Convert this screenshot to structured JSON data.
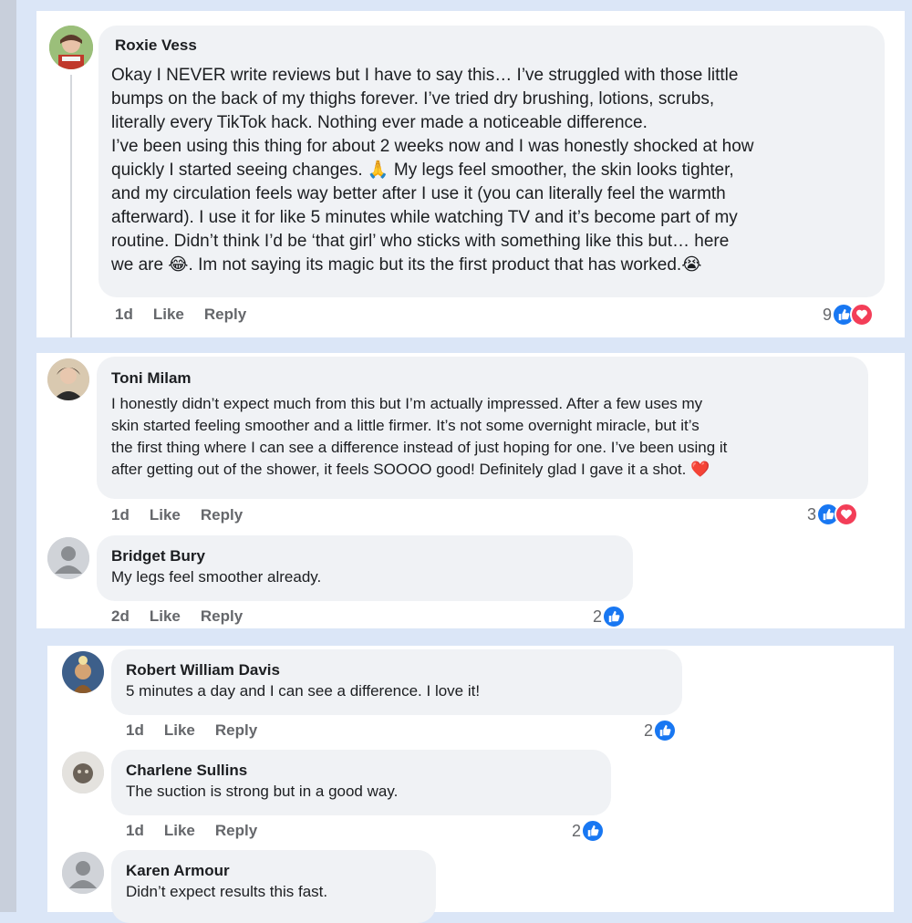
{
  "comments": [
    {
      "name": "Roxie Vess",
      "lines": [
        "Okay I NEVER write reviews but I have to say this… I’ve struggled with those little",
        "bumps on the back of my thighs forever. I’ve tried dry brushing, lotions, scrubs,",
        "literally every TikTok hack. Nothing ever made a noticeable difference.",
        "I’ve been using this thing for about 2 weeks now and I was honestly shocked at how",
        "quickly I started seeing changes. 🙏 My legs feel smoother, the skin looks tighter,",
        "and my circulation feels way better after I use it (you can literally feel the warmth",
        "afterward). I use it for like 5 minutes while watching TV and it’s become part of my",
        "routine. Didn’t think I’d be ‘that girl’ who sticks with something like this but… here",
        "we are 😂. Im not saying its magic but its the first product that has worked.😭"
      ],
      "time": "1d",
      "like": "Like",
      "reply": "Reply",
      "count": "9",
      "reactions": [
        "like-icon",
        "love-icon"
      ]
    },
    {
      "name": "Toni Milam",
      "lines": [
        "I honestly didn’t expect much from this but I’m actually impressed. After a few uses my",
        "skin started feeling smoother and a little firmer. It’s not some overnight miracle, but it’s",
        "the first thing where I can see a difference instead of just hoping for one. I’ve been using it",
        "after getting out of the shower, it feels SOOOO good! Definitely glad I gave it a shot. ❤️"
      ],
      "time": "1d",
      "like": "Like",
      "reply": "Reply",
      "count": "3",
      "reactions": [
        "like-icon",
        "love-icon"
      ]
    },
    {
      "name": "Bridget Bury",
      "lines": [
        "My legs feel smoother already."
      ],
      "time": "2d",
      "like": "Like",
      "reply": "Reply",
      "count": "2",
      "reactions": [
        "like-icon"
      ]
    },
    {
      "name": "Robert William Davis",
      "lines": [
        "5 minutes a day and I can see a difference. I love it!"
      ],
      "time": "1d",
      "like": "Like",
      "reply": "Reply",
      "count": "2",
      "reactions": [
        "like-icon"
      ]
    },
    {
      "name": "Charlene Sullins",
      "lines": [
        "The suction is strong but in a good way."
      ],
      "time": "1d",
      "like": "Like",
      "reply": "Reply",
      "count": "2",
      "reactions": [
        "like-icon"
      ]
    },
    {
      "name": "Karen Armour",
      "lines": [
        "Didn’t expect results this fast."
      ]
    }
  ],
  "colors": {
    "accent": "#1877f2",
    "love": "#f33e58",
    "bubble": "#f0f2f5",
    "meta_text": "#65676b",
    "background": "#dbe6f7"
  }
}
